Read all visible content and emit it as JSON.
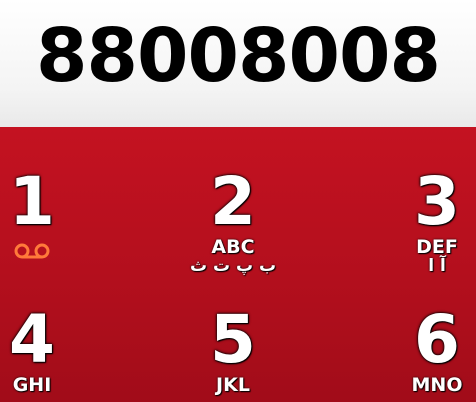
{
  "display": {
    "number": "88008008"
  },
  "keys": [
    {
      "digit": "1",
      "letters": "",
      "arabic": "",
      "icon": "voicemail-icon"
    },
    {
      "digit": "2",
      "letters": "ABC",
      "arabic": "ب پ ت ث"
    },
    {
      "digit": "3",
      "letters": "DEF",
      "arabic": "آ ا"
    },
    {
      "digit": "4",
      "letters": "GHI",
      "arabic": ""
    },
    {
      "digit": "5",
      "letters": "JKL",
      "arabic": ""
    },
    {
      "digit": "6",
      "letters": "MNO",
      "arabic": ""
    }
  ],
  "colors": {
    "keypad_background": "#b30f1d",
    "display_background": "#ffffff",
    "voicemail_icon": "#ff7a3a"
  }
}
